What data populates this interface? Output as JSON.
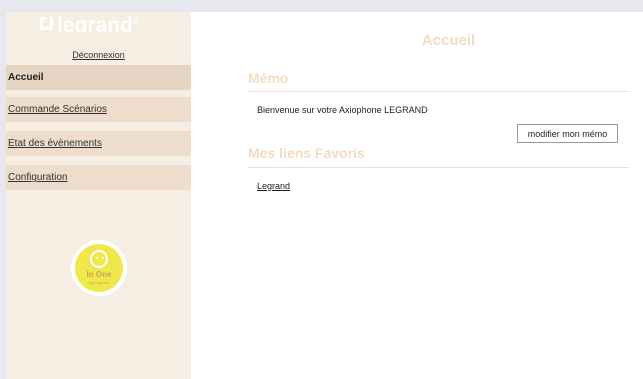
{
  "sidebar": {
    "logo_text": "legrand",
    "logo_mark": "®",
    "logout_label": "Déconnexion",
    "items": [
      {
        "label": "Accueil",
        "active": true
      },
      {
        "label": "Commande Scénarios",
        "active": false
      },
      {
        "label": "Etat des évènements",
        "active": false
      },
      {
        "label": "Configuration",
        "active": false
      }
    ],
    "mascot_text": "In One",
    "mascot_sub": "by Legrand"
  },
  "main": {
    "title": "Accueil",
    "memo_title": "Mémo",
    "memo_text": "Bienvenue sur votre Axiophone LEGRAND",
    "memo_button": "modifier mon mémo",
    "favorites_title": "Mes liens Favoris",
    "favorites": [
      {
        "label": "Legrand"
      }
    ]
  },
  "colors": {
    "sidebar_bg": "#f7eee3",
    "menu_active": "#e6d5c3",
    "menu_item": "#eeddcc",
    "heading": "#f2dcc2"
  }
}
